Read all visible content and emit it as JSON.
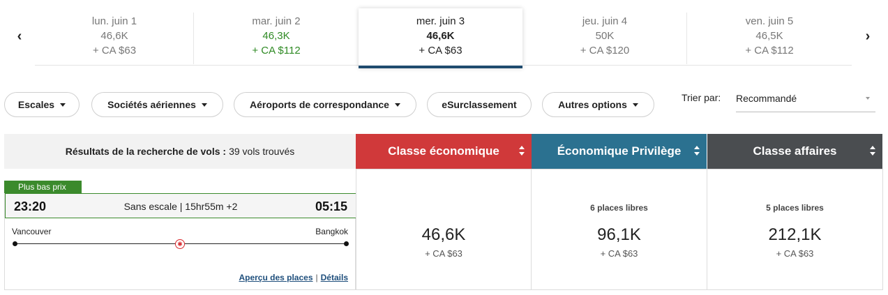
{
  "date_strip": {
    "prev_arrow": "‹",
    "next_arrow": "›",
    "dates": [
      {
        "label": "lun. juin 1",
        "points": "46,6K",
        "tax": "+ CA $63",
        "state": "normal"
      },
      {
        "label": "mar. juin 2",
        "points": "46,3K",
        "tax": "+ CA $112",
        "state": "lowest"
      },
      {
        "label": "mer. juin 3",
        "points": "46,6K",
        "tax": "+ CA $63",
        "state": "selected"
      },
      {
        "label": "jeu. juin 4",
        "points": "50K",
        "tax": "+ CA $120",
        "state": "normal"
      },
      {
        "label": "ven. juin 5",
        "points": "46,5K",
        "tax": "+ CA $112",
        "state": "normal"
      }
    ]
  },
  "filters": {
    "stops": "Escales",
    "airlines": "Sociétés aériennes",
    "airports": "Aéroports de correspondance",
    "upgrade": "eSurclassement",
    "more": "Autres options"
  },
  "sort": {
    "label": "Trier par:",
    "value": "Recommandé"
  },
  "results": {
    "label": "Résultats de la recherche de vols :",
    "count": "39 vols trouvés"
  },
  "cabins": [
    {
      "label": "Classe économique",
      "color": "#d0393a"
    },
    {
      "label": "Économique Privilège",
      "color": "#2b7190"
    },
    {
      "label": "Classe affaires",
      "color": "#4a4d50"
    }
  ],
  "flight": {
    "badge": "Plus bas prix",
    "departure_time": "23:20",
    "arrival_time": "05:15",
    "info": "Sans escale | 15hr55m +2",
    "origin": "Vancouver",
    "destination": "Bangkok",
    "seat_map_link": "Aperçu des places",
    "separator": "|",
    "details_link": "Détails",
    "airline_icon": "maple-leaf-icon",
    "fares": [
      {
        "seats": "",
        "points": "46,6K",
        "tax": "+ CA $63"
      },
      {
        "seats": "6 places libres",
        "points": "96,1K",
        "tax": "+ CA $63"
      },
      {
        "seats": "5 places libres",
        "points": "212,1K",
        "tax": "+ CA $63"
      }
    ]
  }
}
